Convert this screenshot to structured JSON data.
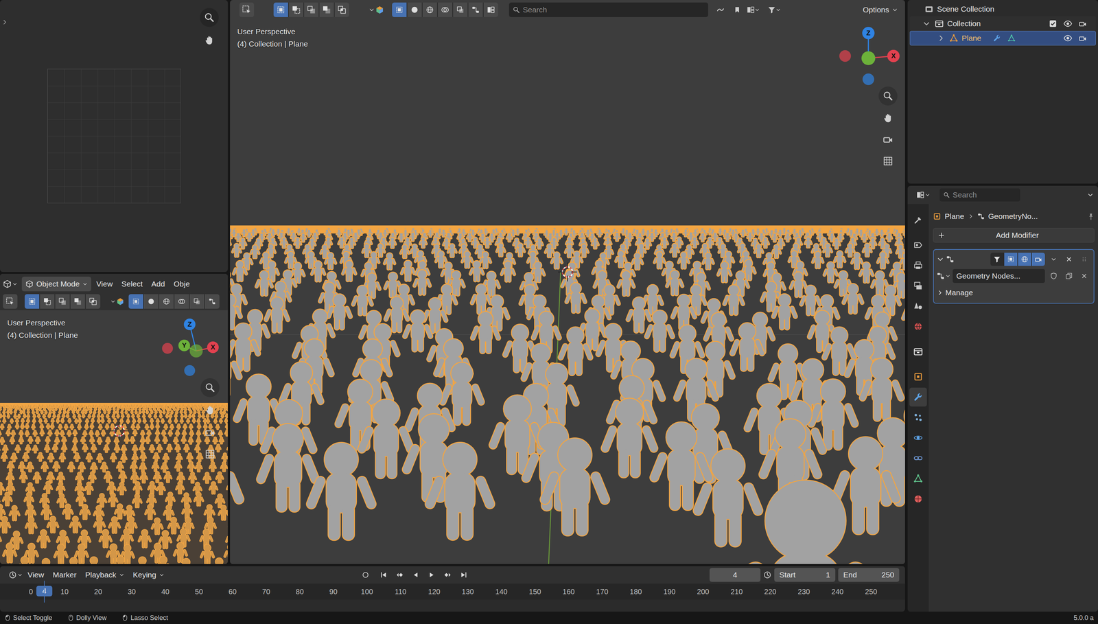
{
  "main_viewport": {
    "header": {
      "select_modes": [
        {
          "selected": true
        },
        {
          "selected": false
        },
        {
          "selected": false
        },
        {
          "selected": false
        },
        {
          "selected": false
        }
      ],
      "toggles": [
        {
          "selected": true
        },
        {
          "selected": false
        },
        {
          "selected": false
        },
        {
          "selected": false
        },
        {
          "selected": false
        },
        {
          "selected": false
        },
        {
          "selected": false
        }
      ],
      "search": {
        "placeholder": "Search"
      },
      "options": "Options"
    },
    "overlay": {
      "view": "User Perspective",
      "context": "(4) Collection | Plane"
    },
    "gizmo": {
      "z": "Z",
      "x": "X"
    }
  },
  "left_viewport": {
    "mode": "Object Mode",
    "menus": [
      "View",
      "Select",
      "Add",
      "Obje"
    ],
    "select_modes": [
      {
        "selected": true
      },
      {
        "selected": false
      },
      {
        "selected": false
      },
      {
        "selected": false
      },
      {
        "selected": false
      }
    ],
    "toggles": [
      {
        "selected": true
      },
      {
        "selected": false
      },
      {
        "selected": false
      },
      {
        "selected": false
      },
      {
        "selected": false
      },
      {
        "selected": false
      }
    ],
    "overlay": {
      "view": "User Perspective",
      "context": "(4) Collection | Plane"
    },
    "gizmo": {
      "z": "Z",
      "y": "Y",
      "x": "X"
    }
  },
  "outliner": {
    "tree": [
      {
        "label": "Scene Collection",
        "kind": "scene",
        "selected": false,
        "children": [
          {
            "label": "Collection",
            "kind": "collection",
            "expanded": true,
            "checked": true,
            "visible": true,
            "selected": false,
            "children": [
              {
                "label": "Plane",
                "kind": "object",
                "expanded": false,
                "visible": true,
                "selected": true,
                "children": []
              }
            ]
          }
        ]
      }
    ]
  },
  "properties": {
    "search": {
      "placeholder": "Search"
    },
    "tab_groups": [
      {
        "tabs": [
          {
            "selected": false
          }
        ]
      },
      {
        "tabs": [
          {
            "selected": false
          },
          {
            "selected": false
          },
          {
            "selected": false
          },
          {
            "selected": false
          },
          {
            "selected": false
          }
        ]
      },
      {
        "tabs": [
          {
            "selected": false
          }
        ]
      },
      {
        "tabs": [
          {
            "selected": false
          },
          {
            "selected": true
          },
          {
            "selected": false
          },
          {
            "selected": false
          },
          {
            "selected": false
          },
          {
            "selected": false
          },
          {
            "selected": false
          }
        ]
      }
    ],
    "breadcrumb": [
      "Plane",
      "GeometryNo..."
    ],
    "add_modifier": "Add Modifier",
    "modifier": {
      "expanded": true,
      "toggles": [
        {
          "on": false
        },
        {
          "on": true
        },
        {
          "on": true
        },
        {
          "on": true
        }
      ],
      "node_group": "Geometry Nodes...",
      "manage": {
        "label": "Manage",
        "expanded": false
      }
    }
  },
  "timeline": {
    "menus": [
      {
        "label": "View",
        "kind": "menu"
      },
      {
        "label": "Marker",
        "kind": "menu"
      },
      {
        "label": "Playback",
        "kind": "dropdown"
      },
      {
        "label": "Keying",
        "kind": "dropdown"
      }
    ],
    "frame_field": "4",
    "start": {
      "label": "Start",
      "value": "1"
    },
    "end": {
      "label": "End",
      "value": "250"
    },
    "ruler": [
      "0",
      "10",
      "20",
      "30",
      "40",
      "50",
      "60",
      "70",
      "80",
      "90",
      "100",
      "110",
      "120",
      "130",
      "140",
      "150",
      "160",
      "170",
      "180",
      "190",
      "200",
      "210",
      "220",
      "230",
      "240",
      "250"
    ],
    "playhead": "4"
  },
  "status_bar": {
    "items": [
      "Select Toggle",
      "Dolly View",
      "Lasso Select"
    ],
    "version": "5.0.0 a"
  }
}
